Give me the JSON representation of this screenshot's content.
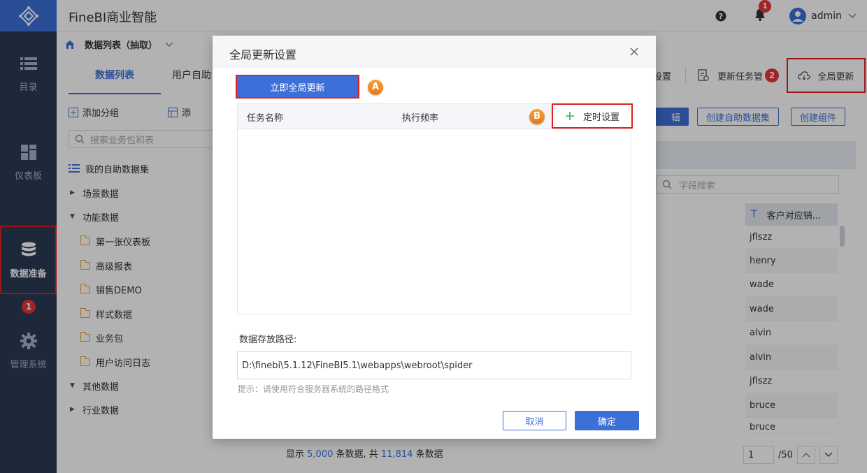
{
  "app": {
    "title": "FineBI商业智能",
    "user": "admin",
    "notification_count": "1"
  },
  "sidebar": {
    "items": [
      {
        "label": "目录"
      },
      {
        "label": "仪表板"
      },
      {
        "label": "数据准备"
      },
      {
        "label": "管理系统"
      }
    ],
    "step_badge": "1"
  },
  "breadcrumb": {
    "label": "数据列表（抽取）"
  },
  "left": {
    "tabs": [
      "数据列表",
      "用户自助"
    ],
    "tools": {
      "add_group": "添加分组",
      "add_more": "添"
    },
    "search_placeholder": "搜索业务包和表",
    "tree": [
      {
        "label": "我的自助数据集"
      },
      {
        "label": "场景数据"
      },
      {
        "label": "功能数据"
      },
      {
        "label": "第一张仪表板"
      },
      {
        "label": "高级报表"
      },
      {
        "label": "销售DEMO"
      },
      {
        "label": "样式数据"
      },
      {
        "label": "业务包"
      },
      {
        "label": "用户访问日志"
      },
      {
        "label": "其他数据"
      },
      {
        "label": "行业数据"
      }
    ]
  },
  "right": {
    "toolbar": {
      "settings": "设置",
      "task_mgmt": "更新任务管",
      "step_badge": "2",
      "global_update": "全局更新"
    },
    "buttons": {
      "edit": "辑",
      "create_self_dataset": "创建自助数据集",
      "create_component": "创建组件"
    },
    "field_search_placeholder": "字段搜索",
    "column_header": "客户对应销...",
    "rows": [
      "jflszz",
      "henry",
      "wade",
      "wade",
      "alvin",
      "alvin",
      "jflszz",
      "bruce",
      "bruce"
    ],
    "footer": {
      "show": "显示",
      "shown_count": "5,000",
      "unit1": "条数据, 共",
      "total_count": "11,814",
      "unit2": "条数据"
    },
    "pager": {
      "current": "1",
      "total": "/50"
    }
  },
  "modal": {
    "title": "全局更新设置",
    "update_now": "立即全局更新",
    "marker_a": "A",
    "marker_b": "B",
    "col_task_name": "任务名称",
    "col_frequency": "执行频率",
    "timer_setting": "定时设置",
    "path_label": "数据存放路径:",
    "path_value": "D:\\finebi\\5.1.12\\FineBI5.1\\webapps\\webroot\\spider",
    "hint": "提示：请使用符合服务器系统的路径格式",
    "cancel": "取消",
    "confirm": "确定"
  }
}
